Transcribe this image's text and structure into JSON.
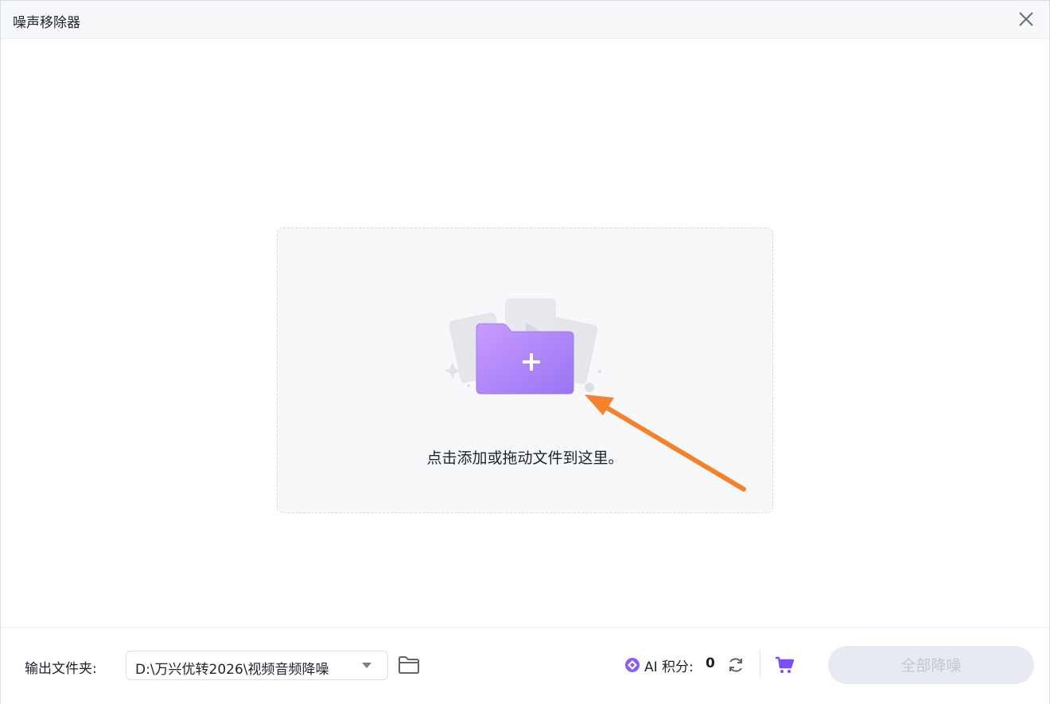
{
  "window": {
    "title": "噪声移除器",
    "close_icon": "close-icon"
  },
  "dropzone": {
    "text": "点击添加或拖动文件到这里。",
    "icon": "add-folder-icon"
  },
  "footer": {
    "output_label": "输出文件夹:",
    "output_path": "D:\\万兴优转2026\\视频音频降噪",
    "ai_points_label": "AI 积分:",
    "ai_points_value": "0",
    "primary_button": "全部降噪"
  },
  "colors": {
    "accent": "#8b5cf6",
    "annotation_arrow": "#f5822a",
    "disabled_button_bg": "#e8eaf1",
    "disabled_button_text": "#c3c7d2"
  }
}
